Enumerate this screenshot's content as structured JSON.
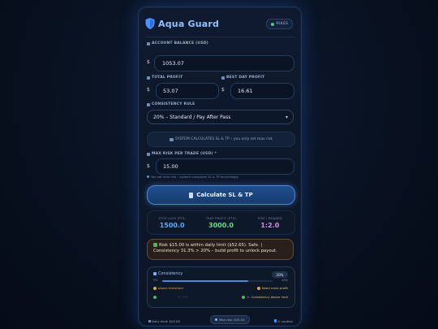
{
  "app": {
    "title": "Aqua Guard",
    "rules_label": "RULES"
  },
  "balance": {
    "label": "ACCOUNT BALANCE (USD)",
    "currency": "$",
    "value": "1053.07"
  },
  "total_profit": {
    "label": "TOTAL PROFIT",
    "currency": "$",
    "value": "53.07"
  },
  "best_day": {
    "label": "BEST DAY PROFIT",
    "currency": "$",
    "value": "16.61"
  },
  "consistency_rule": {
    "label": "CONSISTENCY RULE",
    "selected": "20% – Standard / Pay After Pass"
  },
  "info_banner": "SYSTEM CALCULATES SL & TP – you only set max risk",
  "max_risk": {
    "label": "MAX RISK PER TRADE (USD) *",
    "currency": "$",
    "value": "15.00",
    "hint": "You set max risk – system computes SL & TP accordingly"
  },
  "calculate_button": "Calculate SL & TP",
  "stats": [
    {
      "label": "STOP LOSS (PTS)",
      "value": "1500.0",
      "color": "#5aa8ff"
    },
    {
      "label": "TAKE PROFIT (PTS)",
      "value": "3000.0",
      "color": "#5fe07d"
    },
    {
      "label": "RISK / REWARD",
      "value": "1:2.0",
      "color": "#d88cf0"
    }
  ],
  "alert": {
    "line1": "Risk $15.00 is within daily limit ($52.65). Safe. |",
    "line2": "Consistency 31.3% > 20% – build profit to unlock payout."
  },
  "consistency": {
    "title": "Consistency",
    "badge": "20%",
    "bar_value": "31.3%",
    "tick_left": "0%",
    "tick_right": "40%",
    "legend_above": "above threshold",
    "legend_need": "Need more profit",
    "legend_warn": "Consistency above limit",
    "legend_mid": "31.3%"
  },
  "footer": {
    "daily_limit": "Daily limit: $52.65",
    "max_risk": "Max risk: $15.00",
    "status": "caution"
  }
}
